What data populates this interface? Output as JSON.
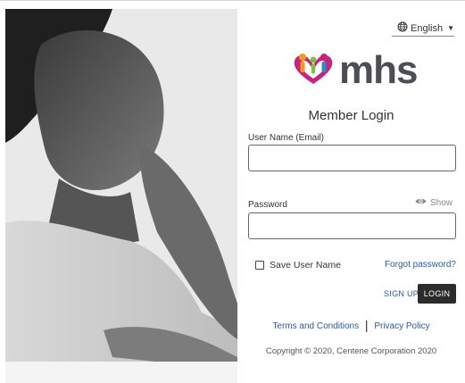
{
  "language": {
    "label": "English",
    "icon": "globe-icon",
    "caret_icon": "caret-down-icon"
  },
  "brand": {
    "wordmark": "mhs",
    "logo_icon": "people-heart-logo",
    "colors": {
      "orange": "#f29a1f",
      "green": "#7ac143",
      "magenta": "#c8247e",
      "blue": "#2f88c8",
      "gray": "#4b4e54"
    }
  },
  "login": {
    "heading": "Member Login",
    "username_label": "User Name (Email)",
    "username_value": "",
    "password_label": "Password",
    "password_value": "",
    "show_label": "Show",
    "show_icon": "eye-icon",
    "save_username_label": "Save User Name",
    "save_username_checked": false,
    "forgot_password": "Forgot password?",
    "signup": "SIGN UP",
    "login_button": "LOGIN"
  },
  "footer": {
    "terms": "Terms and Conditions",
    "separator": "|",
    "privacy": "Privacy Policy",
    "copyright": "Copyright © 2020, Centene Corporation 2020"
  },
  "colors": {
    "link": "#2c5a9e",
    "button_bg": "#2b2b2b"
  }
}
